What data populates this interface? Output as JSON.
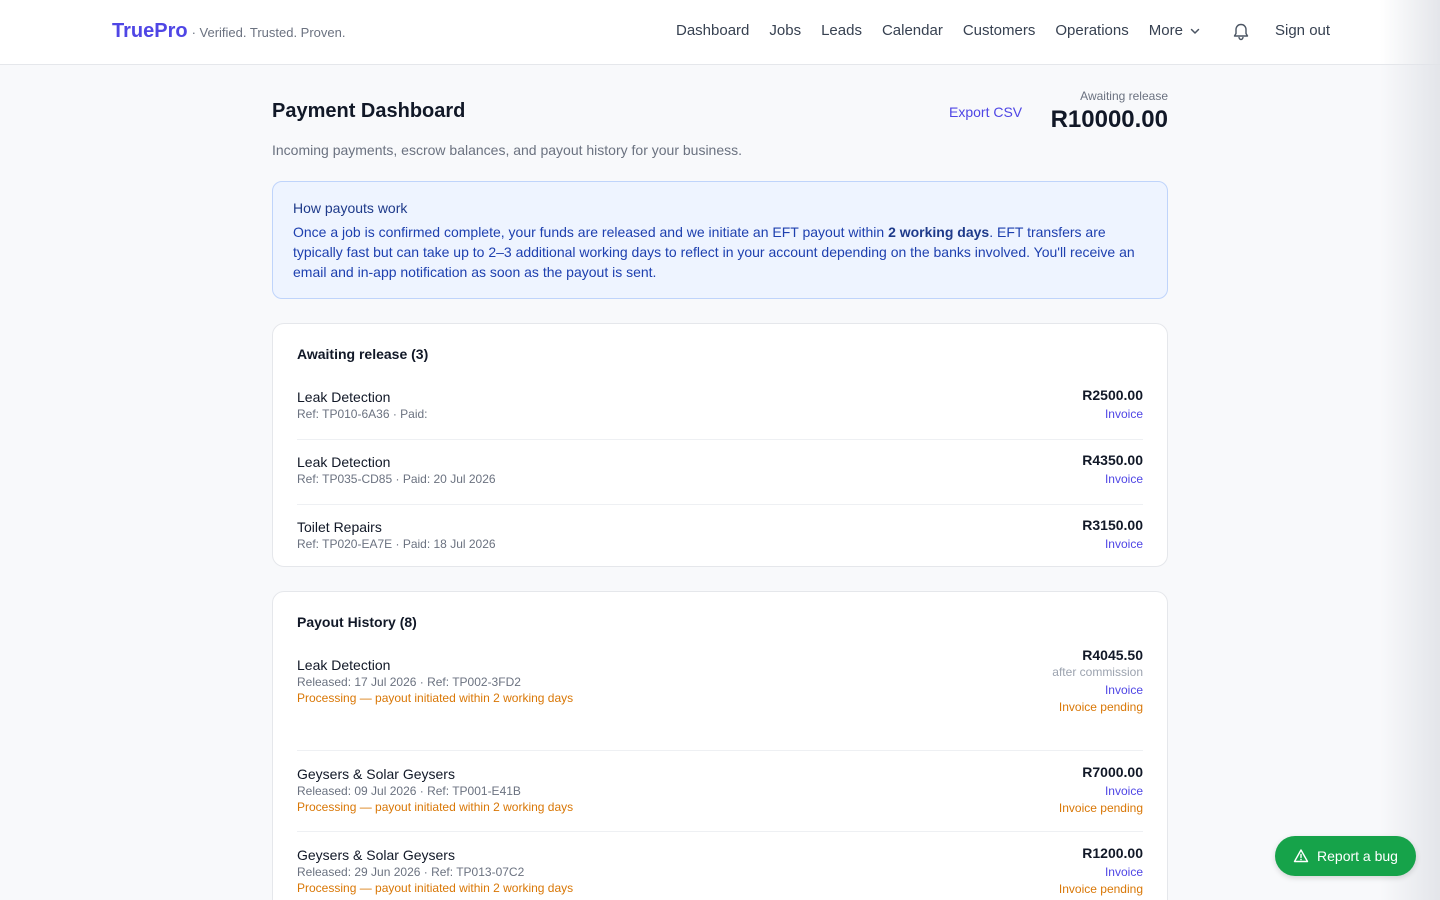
{
  "brand": {
    "name": "TruePro",
    "tagline": "· Verified. Trusted. Proven."
  },
  "nav": {
    "items": [
      "Dashboard",
      "Jobs",
      "Leads",
      "Calendar",
      "Customers",
      "Operations"
    ],
    "more_label": "More",
    "signout_label": "Sign out"
  },
  "page": {
    "title": "Payment Dashboard",
    "subtitle": "Incoming payments, escrow balances, and payout history for your business.",
    "export_label": "Export CSV",
    "awaiting_label": "Awaiting release",
    "awaiting_amount": "R10000.00"
  },
  "info": {
    "title": "How payouts work",
    "body_pre": "Once a job is confirmed complete, your funds are released and we initiate an EFT payout within ",
    "body_bold": "2 working days",
    "body_post": ". EFT transfers are typically fast but can take up to 2–3 additional working days to reflect in your account depending on the banks involved. You'll receive an email and in-app notification as soon as the payout is sent."
  },
  "awaiting": {
    "title": "Awaiting release (3)",
    "rows": [
      {
        "title": "Leak Detection",
        "meta": "Ref: TP010-6A36 · Paid:",
        "amount": "R2500.00",
        "invoice": "Invoice"
      },
      {
        "title": "Leak Detection",
        "meta": "Ref: TP035-CD85 · Paid: 20 Jul 2026",
        "amount": "R4350.00",
        "invoice": "Invoice"
      },
      {
        "title": "Toilet Repairs",
        "meta": "Ref: TP020-EA7E · Paid: 18 Jul 2026",
        "amount": "R3150.00",
        "invoice": "Invoice"
      }
    ]
  },
  "payouts": {
    "title": "Payout History (8)",
    "rows": [
      {
        "title": "Leak Detection",
        "meta": "Released: 17 Jul 2026 · Ref: TP002-3FD2",
        "status": "Processing — payout initiated within 2 working days",
        "amount": "R4045.50",
        "note": "after commission",
        "invoice": "Invoice",
        "invoice_status": "Invoice pending"
      },
      {
        "title": "Geysers & Solar Geysers",
        "meta": "Released: 09 Jul 2026 · Ref: TP001-E41B",
        "status": "Processing — payout initiated within 2 working days",
        "amount": "R7000.00",
        "invoice": "Invoice",
        "invoice_status": "Invoice pending"
      },
      {
        "title": "Geysers & Solar Geysers",
        "meta": "Released: 29 Jun 2026 · Ref: TP013-07C2",
        "status": "Processing — payout initiated within 2 working days",
        "amount": "R1200.00",
        "invoice": "Invoice",
        "invoice_status": "Invoice pending"
      }
    ]
  },
  "bug_button": {
    "label": "Report a bug"
  },
  "colors": {
    "brand": "#4f46e5",
    "processing": "#d97706",
    "bug": "#16a34a"
  },
  "icons": {
    "bell": "bell-icon",
    "chevron": "chevron-down-icon",
    "warning": "warning-triangle-icon"
  }
}
